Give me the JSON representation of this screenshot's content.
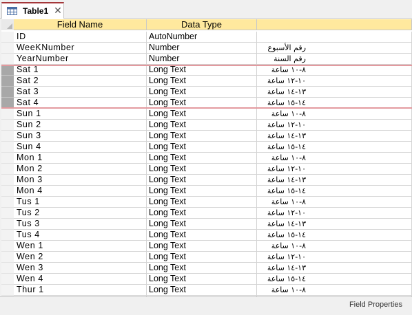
{
  "tab": {
    "label": "Table1",
    "icon": "table-icon",
    "close_glyph": "✕"
  },
  "columns": {
    "field_name": "Field Name",
    "data_type": "Data Type",
    "description": ""
  },
  "rows": [
    {
      "name": "ID",
      "type": "AutoNumber",
      "desc": "",
      "selected": false
    },
    {
      "name": "WeeKNumber",
      "type": "Number",
      "desc": "رقم الأسبوع",
      "selected": false
    },
    {
      "name": "YearNumber",
      "type": "Number",
      "desc": "رقم السنة",
      "selected": false
    },
    {
      "name": "Sat  1",
      "type": "Long Text",
      "desc": "٨-١٠ ساعة",
      "selected": true
    },
    {
      "name": "Sat  2",
      "type": "Long Text",
      "desc": "١٠-١٢ ساعة",
      "selected": true
    },
    {
      "name": "Sat  3",
      "type": "Long Text",
      "desc": "١٣-١٤ ساعة",
      "selected": true
    },
    {
      "name": "Sat  4",
      "type": "Long Text",
      "desc": "١٤-١٥ ساعة",
      "selected": true
    },
    {
      "name": "Sun  1",
      "type": "Long Text",
      "desc": "٨-١٠ ساعة",
      "selected": false
    },
    {
      "name": "Sun  2",
      "type": "Long Text",
      "desc": "١٠-١٢ ساعة",
      "selected": false
    },
    {
      "name": "Sun  3",
      "type": "Long Text",
      "desc": "١٣-١٤ ساعة",
      "selected": false
    },
    {
      "name": "Sun  4",
      "type": "Long Text",
      "desc": "١٤-١٥ ساعة",
      "selected": false
    },
    {
      "name": "Mon  1",
      "type": "Long Text",
      "desc": "٨-١٠ ساعة",
      "selected": false
    },
    {
      "name": "Mon  2",
      "type": "Long Text",
      "desc": "١٠-١٢ ساعة",
      "selected": false
    },
    {
      "name": "Mon  3",
      "type": "Long Text",
      "desc": "١٣-١٤ ساعة",
      "selected": false
    },
    {
      "name": "Mon  4",
      "type": "Long Text",
      "desc": "١٤-١٥ ساعة",
      "selected": false
    },
    {
      "name": "Tus  1",
      "type": "Long Text",
      "desc": "٨-١٠ ساعة",
      "selected": false
    },
    {
      "name": "Tus  2",
      "type": "Long Text",
      "desc": "١٠-١٢ ساعة",
      "selected": false
    },
    {
      "name": "Tus  3",
      "type": "Long Text",
      "desc": "١٣-١٤ ساعة",
      "selected": false
    },
    {
      "name": "Tus  4",
      "type": "Long Text",
      "desc": "١٤-١٥ ساعة",
      "selected": false
    },
    {
      "name": "Wen  1",
      "type": "Long Text",
      "desc": "٨-١٠ ساعة",
      "selected": false
    },
    {
      "name": "Wen  2",
      "type": "Long Text",
      "desc": "١٠-١٢ ساعة",
      "selected": false
    },
    {
      "name": "Wen  3",
      "type": "Long Text",
      "desc": "١٣-١٤ ساعة",
      "selected": false
    },
    {
      "name": "Wen  4",
      "type": "Long Text",
      "desc": "١٤-١٥ ساعة",
      "selected": false
    },
    {
      "name": "Thur  1",
      "type": "Long Text",
      "desc": "٨-١٠ ساعة",
      "selected": false
    },
    {
      "name": "",
      "type": "",
      "desc": "",
      "selected": false
    }
  ],
  "footer": {
    "label": "Field Properties"
  },
  "colors": {
    "header": "#ffe99e",
    "selection_border": "#e39a9f",
    "tab_accent": "#a4373a"
  }
}
